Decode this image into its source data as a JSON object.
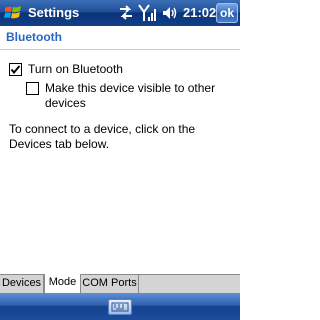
{
  "window": {
    "title": "Settings",
    "ok_label": "ok",
    "time": "21:02"
  },
  "status_icons": [
    "connectivity-icon",
    "signal-icon",
    "volume-icon"
  ],
  "page": {
    "title": "Bluetooth"
  },
  "options": [
    {
      "label": "Turn on Bluetooth",
      "checked": true
    },
    {
      "label": "Make this device visible to other devices",
      "checked": false
    }
  ],
  "info_text": "To connect to a device, click on the Devices tab below.",
  "tabs": [
    {
      "label": "Devices",
      "active": false
    },
    {
      "label": "Mode",
      "active": true
    },
    {
      "label": "COM Ports",
      "active": false
    }
  ],
  "softkeys": {
    "center_icon": "keyboard-icon"
  },
  "colors": {
    "title_blue": "#1f4f98",
    "heading_blue": "#2a67c4"
  }
}
